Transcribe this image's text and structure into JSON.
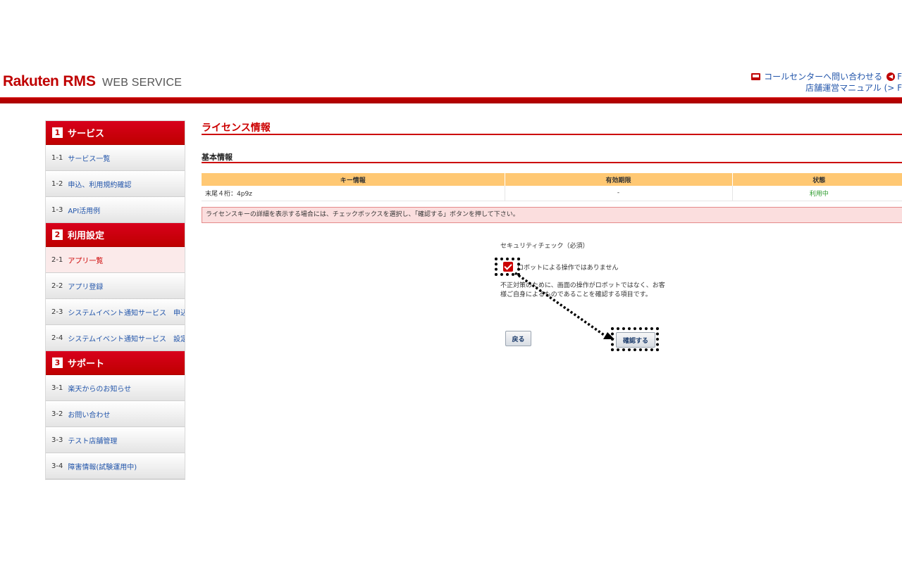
{
  "header": {
    "logo_rakuten": "Rakuten",
    "logo_rms": "RMS",
    "logo_webservice": "WEB SERVICE",
    "link_callcenter": "コールセンターへ問い合わせる",
    "link_back": "F",
    "link_manual": "店舗運営マニュアル (> F"
  },
  "sidebar": {
    "sections": [
      {
        "num": "1",
        "title": "サービス",
        "items": [
          {
            "num": "1-1",
            "label": "サービス一覧"
          },
          {
            "num": "1-2",
            "label": "申込、利用規約確認"
          },
          {
            "num": "1-3",
            "label": "API活用例"
          }
        ]
      },
      {
        "num": "2",
        "title": "利用設定",
        "items": [
          {
            "num": "2-1",
            "label": "アプリ一覧"
          },
          {
            "num": "2-2",
            "label": "アプリ登録"
          },
          {
            "num": "2-3",
            "label": "システムイベント通知サービス　申込"
          },
          {
            "num": "2-4",
            "label": "システムイベント通知サービス　設定"
          }
        ]
      },
      {
        "num": "3",
        "title": "サポート",
        "items": [
          {
            "num": "3-1",
            "label": "楽天からのお知らせ"
          },
          {
            "num": "3-2",
            "label": "お問い合わせ"
          },
          {
            "num": "3-3",
            "label": "テスト店舗管理"
          },
          {
            "num": "3-4",
            "label": "障害情報(試験運用中)"
          }
        ]
      }
    ]
  },
  "main": {
    "page_title": "ライセンス情報",
    "sub_title": "基本情報",
    "table": {
      "headers": [
        "キー情報",
        "有効期限",
        "状態"
      ],
      "row": [
        "末尾４桁：4p9z",
        "-",
        "利用中"
      ]
    },
    "notice": "ライセンスキーの詳細を表示する場合には、チェックボックスを選択し、「確認する」ボタンを押して下さい。",
    "security_heading": "セキュリティチェック（必須）",
    "checkbox_label": "ロボットによる操作ではありません",
    "description": "不正対策のために、画面の操作がロボットではなく、お客様ご自身によるものであることを確認する項目です。",
    "back_button": "戻る",
    "confirm_button": "確認する"
  },
  "colors": {
    "brand": "#bf0000",
    "table_header": "#ffc873",
    "notice_bg": "#fbdede",
    "status_ok": "#2a9a2a"
  }
}
